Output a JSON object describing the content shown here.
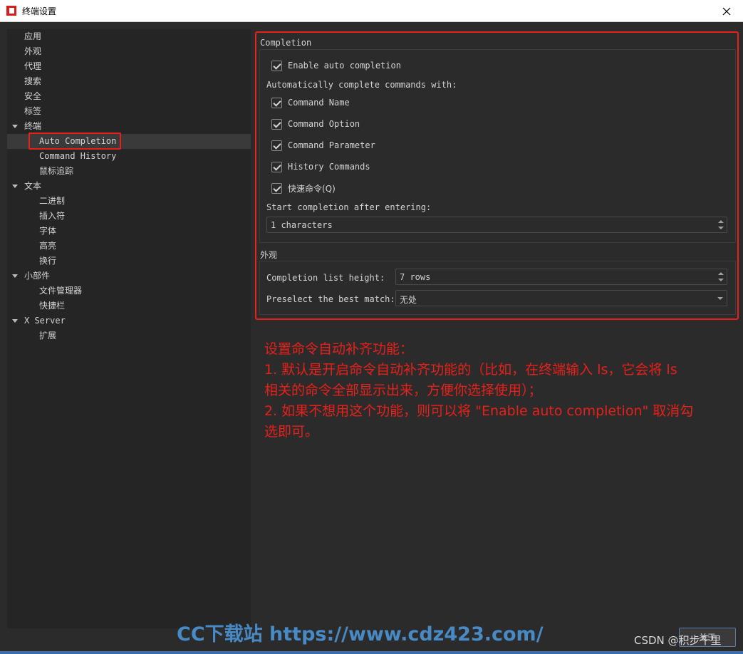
{
  "window": {
    "title": "终端设置",
    "colors": {
      "background": "#2b2b2b",
      "sidebar": "#252526",
      "annotation_red": "#e8201a",
      "app_icon_red": "#d91c1c"
    }
  },
  "sidebar": {
    "items": [
      {
        "label": "应用"
      },
      {
        "label": "外观"
      },
      {
        "label": "代理"
      },
      {
        "label": "搜索"
      },
      {
        "label": "安全"
      },
      {
        "label": "标签"
      },
      {
        "label": "终端"
      },
      {
        "label": "Auto Completion",
        "selected": true
      },
      {
        "label": "Command History"
      },
      {
        "label": "鼠标追踪"
      },
      {
        "label": "文本"
      },
      {
        "label": "二进制"
      },
      {
        "label": "插入符"
      },
      {
        "label": "字体"
      },
      {
        "label": "高亮"
      },
      {
        "label": "换行"
      },
      {
        "label": "小部件"
      },
      {
        "label": "文件管理器"
      },
      {
        "label": "快捷栏"
      },
      {
        "label": "X Server"
      },
      {
        "label": "扩展"
      }
    ]
  },
  "completion": {
    "group_title": "Completion",
    "enable_label": "Enable auto completion",
    "enable_checked": true,
    "auto_complete_label": "Automatically complete commands with:",
    "options": [
      {
        "label": "Command Name",
        "checked": true
      },
      {
        "label": "Command Option",
        "checked": true
      },
      {
        "label": "Command Parameter",
        "checked": true
      },
      {
        "label": "History Commands",
        "checked": true
      },
      {
        "label": "快速命令(Q)",
        "checked": true
      }
    ],
    "start_after_label": "Start completion after entering:",
    "start_after_value": "1 characters"
  },
  "appearance": {
    "group_title": "外观",
    "list_height_label": "Completion list height:",
    "list_height_value": "7 rows",
    "preselect_label": "Preselect the best match:",
    "preselect_value": "无处"
  },
  "annotation": {
    "lines": [
      "设置命令自动补齐功能：",
      "1. 默认是开启命令自动补齐功能的（比如，在终端输入 ls，它会将 ls",
      "相关的命令全部显示出来，方便你选择使用）；",
      "2. 如果不想用这个功能，则可以将 \"Enable auto completion\" 取消勾",
      "选即可。"
    ]
  },
  "footer": {
    "watermark": "CC下载站 https://www.cdz423.com/",
    "csdn_mark": "CSDN @积步千里",
    "about_button": "关于"
  }
}
